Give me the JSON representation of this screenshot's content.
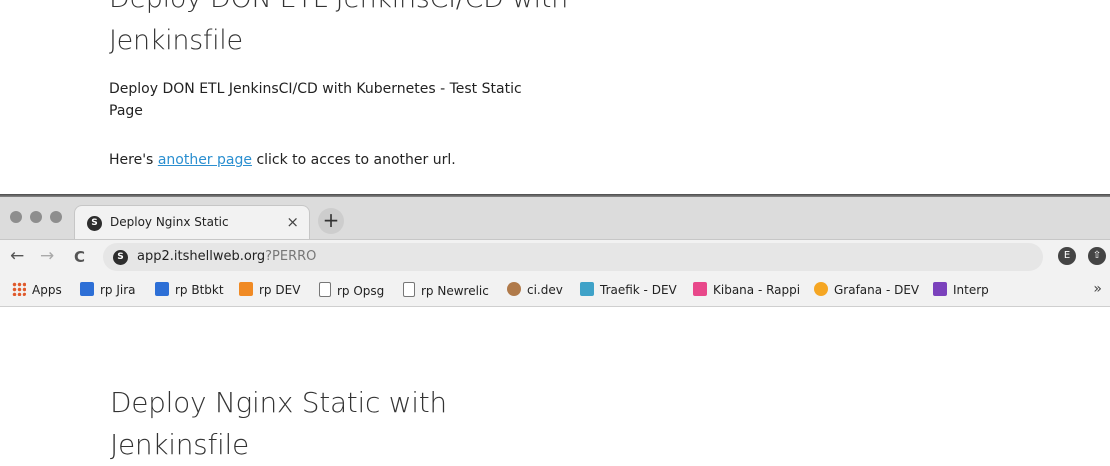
{
  "background_page": {
    "title": "Deploy DON ETL JenkinsCI/CD with Jenkinsfile",
    "description": "Deploy DON ETL JenkinsCI/CD with Kubernetes - Test Static Page",
    "link_prefix": "Here's",
    "link_text": "another page",
    "link_suffix": "click to acces to another url."
  },
  "tab": {
    "title": "Deploy Nginx Static",
    "favicon": "S",
    "close": "×"
  },
  "newtab": "+",
  "nav": {
    "back": "←",
    "forward": "→",
    "reload": "C"
  },
  "url": {
    "host": "app2.itshellweb.org",
    "rest": "?PERRO",
    "site_icon": "S"
  },
  "extensions": [
    "E",
    "⇧"
  ],
  "bookmarks": [
    {
      "label": "Apps",
      "icon_color": "#e05a2b"
    },
    {
      "label": "rp Jira",
      "icon_color": "#2d6fd6"
    },
    {
      "label": "rp Btbkt",
      "icon_color": "#2d6fd6"
    },
    {
      "label": "rp DEV",
      "icon_color": "#f08a24"
    },
    {
      "label": "rp Opsg",
      "icon_color": "#ffffff"
    },
    {
      "label": "rp Newrelic",
      "icon_color": "#ffffff"
    },
    {
      "label": "ci.dev",
      "icon_color": "#b07a4a"
    },
    {
      "label": "Traefik - DEV",
      "icon_color": "#3fa2c8"
    },
    {
      "label": "Kibana - Rappi",
      "icon_color": "#e8488a"
    },
    {
      "label": "Grafana - DEV",
      "icon_color": "#f5a623"
    },
    {
      "label": "Interp",
      "icon_color": "#7b42bc"
    }
  ],
  "bookmarks_more": "»",
  "main_page": {
    "title": "Deploy Nginx Static with Jenkinsfile"
  }
}
